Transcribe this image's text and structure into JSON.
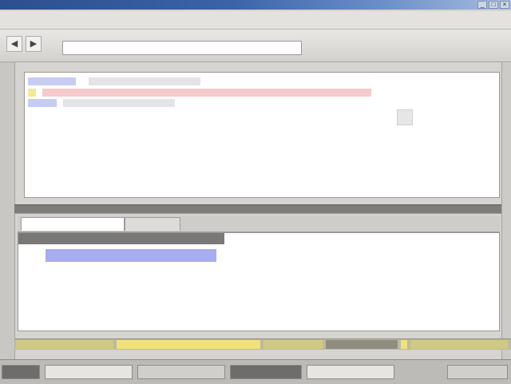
{
  "window": {
    "title": "",
    "title_color": "#2c4f8e"
  },
  "titlebar": {
    "buttons": [
      {
        "icon": "minimize-icon",
        "glyph": "_"
      },
      {
        "icon": "maximize-icon",
        "glyph": "□"
      },
      {
        "icon": "close-icon",
        "glyph": "×"
      }
    ]
  },
  "menubar": {
    "items": []
  },
  "toolbar": {
    "buttons": [
      {
        "icon": "back-icon",
        "glyph": "◀"
      },
      {
        "icon": "forward-icon",
        "glyph": "▶"
      }
    ],
    "address_value": ""
  },
  "editor": {
    "highlight_colors": {
      "blue": "#c8ccf3",
      "red": "#f6c9cc",
      "yellow": "#f2ea96",
      "gray": "#e4e4e7"
    }
  },
  "bottom_panel": {
    "tabs": [],
    "header_label": "",
    "selected_row": ""
  },
  "statusbar": {
    "accent": "#efe27a"
  }
}
